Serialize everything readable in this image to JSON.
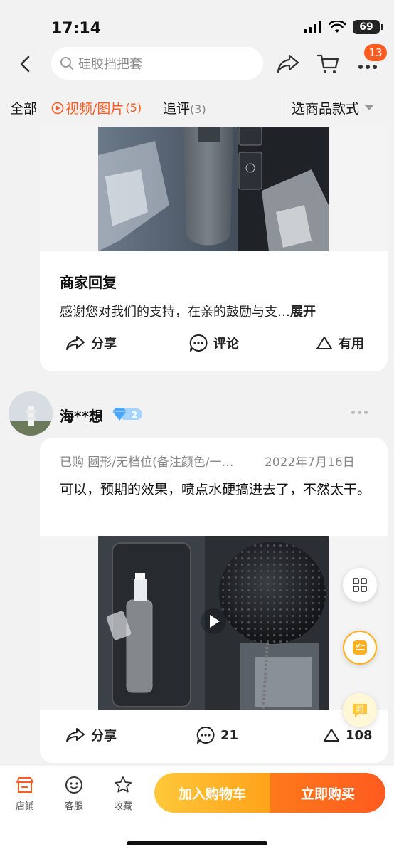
{
  "status_bar": {
    "time": "17:14",
    "battery": "69"
  },
  "nav": {
    "search_placeholder": "硅胶挡把套",
    "message_count": "13"
  },
  "tabs": [
    {
      "label": "全部",
      "count": ""
    },
    {
      "label": "视频/图片",
      "count": "(5)"
    },
    {
      "label": "追评",
      "count": "(3)"
    }
  ],
  "style_select": {
    "label": "选商品款式"
  },
  "review1": {
    "reply_title": "商家回复",
    "reply_text": "感谢您对我们的支持，在亲的鼓励与支…",
    "expand": "展开",
    "actions": {
      "share": "分享",
      "comment": "评论",
      "useful": "有用"
    }
  },
  "review2": {
    "username": "海**想",
    "vip_level": "2",
    "purchase_label": "已购",
    "variant": "圆形/无档位(备注颜色/一…",
    "date": "2022年7月16日",
    "text": "可以，预期的效果，喷点水硬搞进去了，不然太干。",
    "actions": {
      "share": "分享",
      "comments": "21",
      "likes": "108"
    }
  },
  "bottom_bar": {
    "shop": "店铺",
    "service": "客服",
    "favorite": "收藏",
    "add_to_cart": "加入购物车",
    "buy_now": "立即购买"
  },
  "colors": {
    "accent": "#ff5a1f",
    "cart_button": "#ffb020",
    "buy_button": "#ff5a1f"
  }
}
